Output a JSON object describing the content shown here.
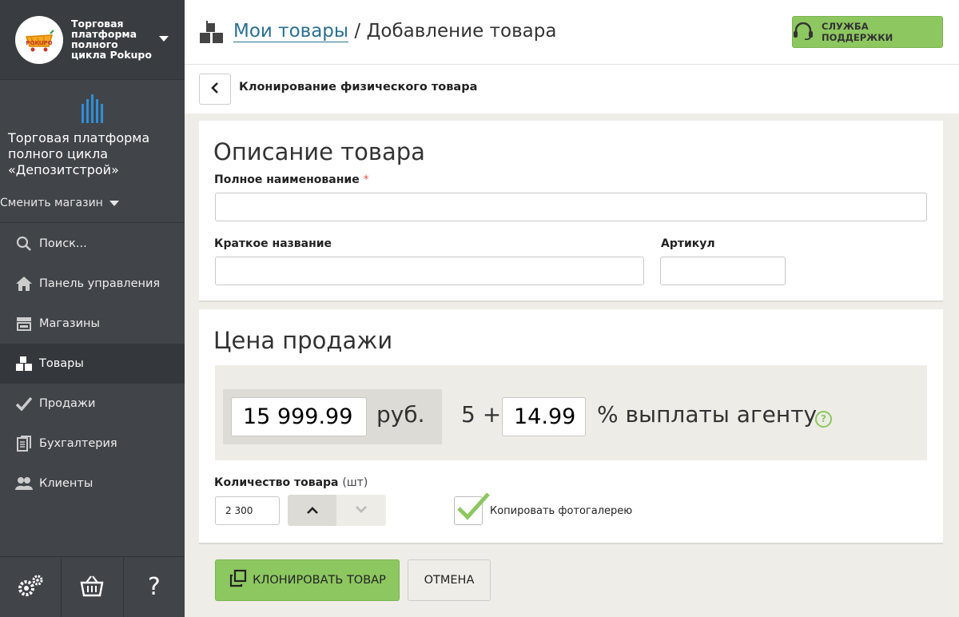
{
  "sidebar": {
    "platform_title": "Торговая платформа полного цикла Pokupo",
    "logo_text": "POKUPO",
    "store_name": "Торговая платформа полного цикла «Депозитстрой»",
    "change_store": "Сменить магазин",
    "items": [
      {
        "label": "Поиск...",
        "icon": "search-icon"
      },
      {
        "label": "Панель управления",
        "icon": "home-icon"
      },
      {
        "label": "Магазины",
        "icon": "store-icon"
      },
      {
        "label": "Товары",
        "icon": "boxes-icon",
        "active": true
      },
      {
        "label": "Продажи",
        "icon": "check-icon"
      },
      {
        "label": "Бухгалтерия",
        "icon": "documents-icon"
      },
      {
        "label": "Клиенты",
        "icon": "users-icon"
      }
    ],
    "bottom": {
      "help": "?"
    }
  },
  "header": {
    "breadcrumb_link": "Мои товары",
    "breadcrumb_separator": " / ",
    "breadcrumb_current": "Добавление товара",
    "support_button": "СЛУЖБА ПОДДЕРЖКИ"
  },
  "subheader": {
    "title": "Клонирование физического товара"
  },
  "description": {
    "heading": "Описание товара",
    "full_name_label": "Полное наименование",
    "required_mark": "*",
    "full_name_value": "",
    "short_name_label": "Краткое название",
    "short_name_value": "",
    "sku_label": "Артикул",
    "sku_value": ""
  },
  "price": {
    "heading": "Цена продажи",
    "amount": "15 999.99",
    "currency": "руб.",
    "plus_prefix": "5 +",
    "agent_percent": "14.99",
    "agent_label": "% выплаты агенту",
    "help": "?",
    "quantity_label": "Количество товара",
    "quantity_unit": "(шт)",
    "quantity_value": "2 300",
    "copy_gallery_label": "Копировать фотогалерею",
    "copy_gallery_checked": true
  },
  "actions": {
    "clone_button": "КЛОНИРОВАТЬ ТОВАР",
    "cancel_button": "ОТМЕНА"
  },
  "colors": {
    "accent": "#8dc760",
    "sidebar": "#414449",
    "link": "#2c6f8f"
  }
}
